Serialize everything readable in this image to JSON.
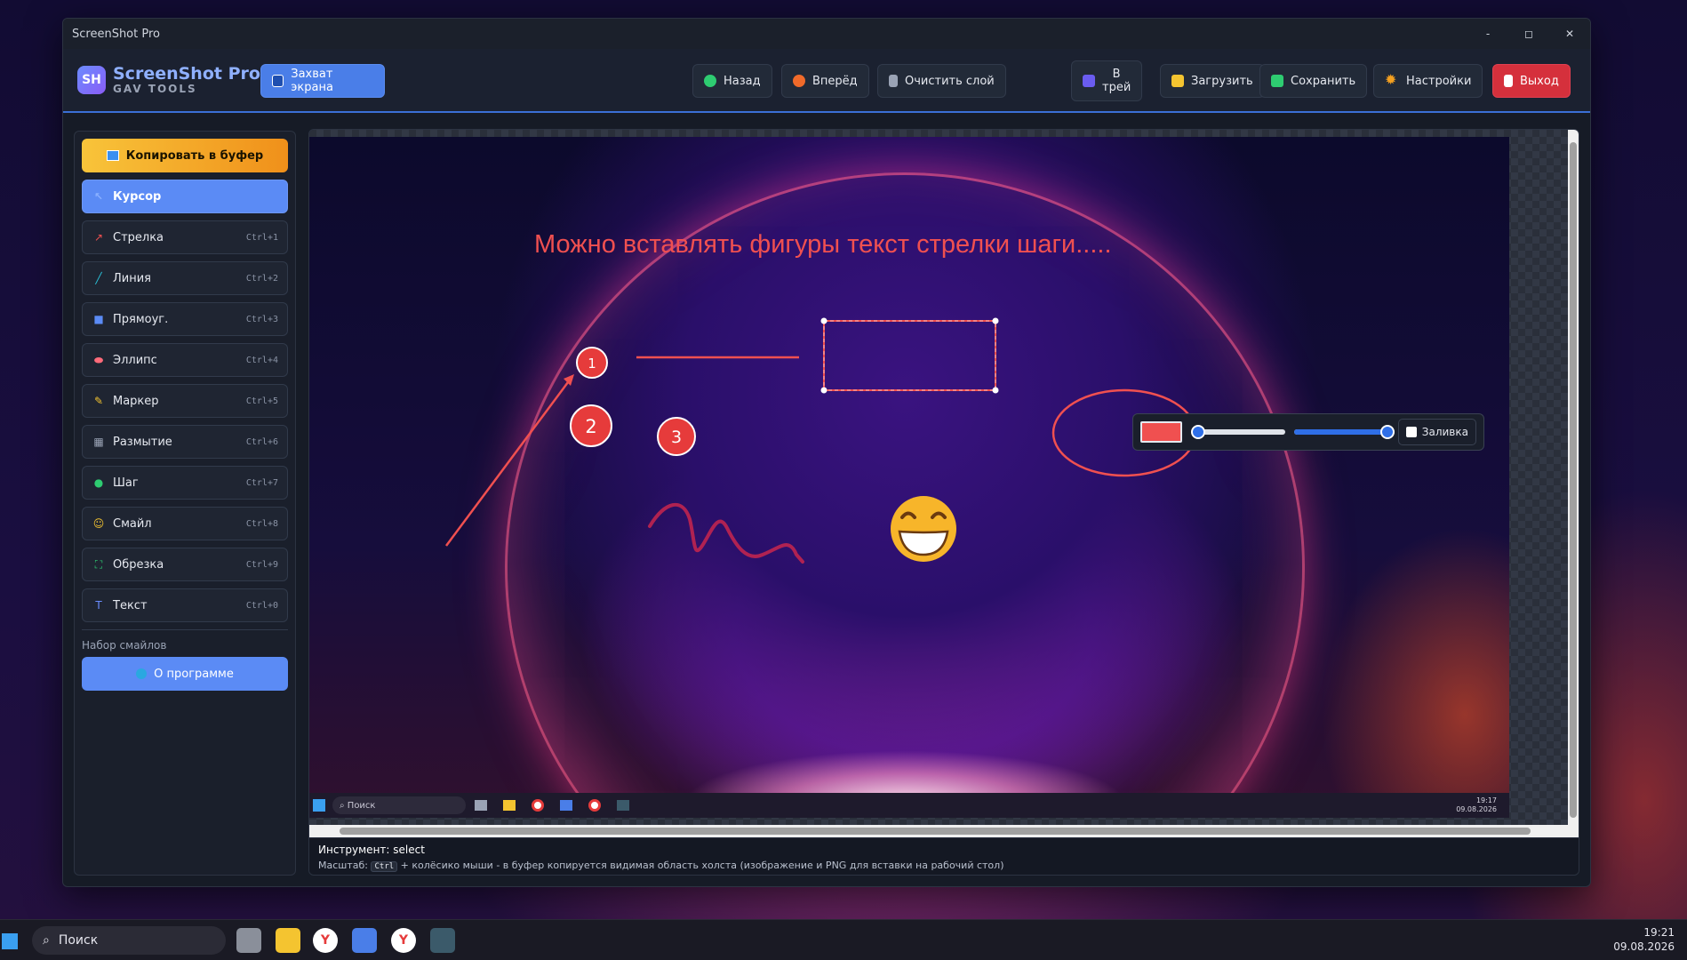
{
  "window": {
    "title": "ScreenShot Pro",
    "controls": {
      "minimize": "-",
      "maximize": "◻",
      "close": "✕"
    }
  },
  "header": {
    "logo_badge": "SH",
    "logo_name": "ScreenShot Pro",
    "logo_sub": "GAV TOOLS",
    "capture": "Захват экрана",
    "back": "Назад",
    "forward": "Вперёд",
    "clear": "Очистить слой",
    "tray_l1": "В",
    "tray_l2": "трей",
    "load": "Загрузить",
    "save": "Сохранить",
    "settings": "Настройки",
    "exit": "Выход"
  },
  "sidebar": {
    "copy": "Копировать в буфер",
    "tools": [
      {
        "label": "Курсор",
        "shortcut": "",
        "icon": "cursor-icon",
        "active": true
      },
      {
        "label": "Стрелка",
        "shortcut": "Ctrl+1",
        "icon": "arrow-icon"
      },
      {
        "label": "Линия",
        "shortcut": "Ctrl+2",
        "icon": "line-icon"
      },
      {
        "label": "Прямоуг.",
        "shortcut": "Ctrl+3",
        "icon": "rectangle-icon"
      },
      {
        "label": "Эллипс",
        "shortcut": "Ctrl+4",
        "icon": "ellipse-icon"
      },
      {
        "label": "Маркер",
        "shortcut": "Ctrl+5",
        "icon": "marker-icon"
      },
      {
        "label": "Размытие",
        "shortcut": "Ctrl+6",
        "icon": "blur-icon"
      },
      {
        "label": "Шаг",
        "shortcut": "Ctrl+7",
        "icon": "step-icon"
      },
      {
        "label": "Смайл",
        "shortcut": "Ctrl+8",
        "icon": "smile-icon"
      },
      {
        "label": "Обрезка",
        "shortcut": "Ctrl+9",
        "icon": "crop-icon"
      },
      {
        "label": "Текст",
        "shortcut": "Ctrl+0",
        "icon": "text-icon"
      }
    ],
    "section_title": "Набор смайлов",
    "about": "О программе"
  },
  "canvas": {
    "annotation_text": "Можно вставлять фигуры текст стрелки шаги.....",
    "steps": [
      "1",
      "2",
      "3"
    ],
    "emoji": "😁",
    "fill_label": "Заливка",
    "stroke_color": "#f05050",
    "size_slider": 0.08,
    "opacity_slider": 0.95,
    "taskbar": {
      "search": "Поиск",
      "time": "19:17",
      "date": "09.08.2026"
    }
  },
  "status": {
    "tool_line": "Инструмент: select",
    "hint_prefix": "Масштаб:",
    "hint_key": "Ctrl",
    "hint_suffix": "+ колёсико мыши - в буфер копируется видимая область холста (изображение и PNG для вставки на рабочий стол)"
  },
  "taskbar": {
    "search": "Поиск",
    "time": "19:21",
    "date": "09.08.2026"
  },
  "colors": {
    "accent": "#5b8bf5",
    "danger": "#d5303c",
    "annotation": "#f05050"
  }
}
